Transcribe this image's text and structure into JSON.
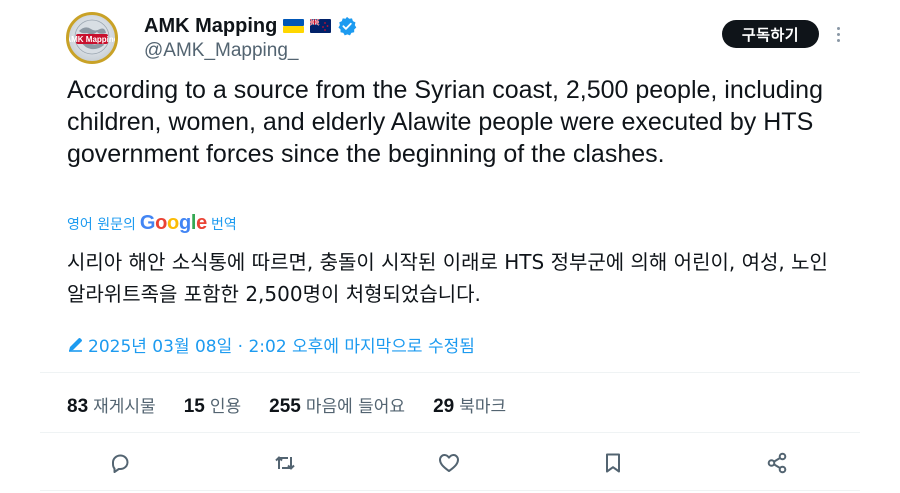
{
  "author": {
    "display_name": "AMK Mapping",
    "handle": "@AMK_Mapping_",
    "avatar_text": "AMK Mapping",
    "flags": [
      "ukraine-flag",
      "new-zealand-flag"
    ],
    "verified": true
  },
  "header": {
    "subscribe_label": "구독하기",
    "more_icon": "more-vertical-icon"
  },
  "tweet": {
    "text": "According to a source from the Syrian coast, 2,500 people, including children, women, and elderly Alawite people were executed by HTS government forces since the beginning of the clashes."
  },
  "translation": {
    "prefix": "영어 원문의",
    "provider": "Google",
    "suffix": "번역",
    "text": "시리아 해안 소식통에 따르면, 충돌이 시작된 이래로 HTS 정부군에 의해 어린이, 여성, 노인 알라위트족을 포함한 2,500명이 처형되었습니다."
  },
  "meta": {
    "edit_icon": "pencil-icon",
    "timestamp": "2025년 03월 08일 · 2:02 오후에 마지막으로 수정됨"
  },
  "stats": [
    {
      "count": "83",
      "label": "재게시물"
    },
    {
      "count": "15",
      "label": "인용"
    },
    {
      "count": "255",
      "label": "마음에 들어요"
    },
    {
      "count": "29",
      "label": "북마크"
    }
  ],
  "actions": [
    "reply-icon",
    "repost-icon",
    "like-icon",
    "bookmark-icon",
    "share-icon"
  ],
  "colors": {
    "accent": "#1d9bf0",
    "text": "#0f1419",
    "secondary": "#536471",
    "button_bg": "#0f1419",
    "divider": "#eff3f4",
    "google_blue": "#4285f4",
    "google_red": "#ea4335",
    "google_yellow": "#fbbc05",
    "google_green": "#34a853"
  }
}
